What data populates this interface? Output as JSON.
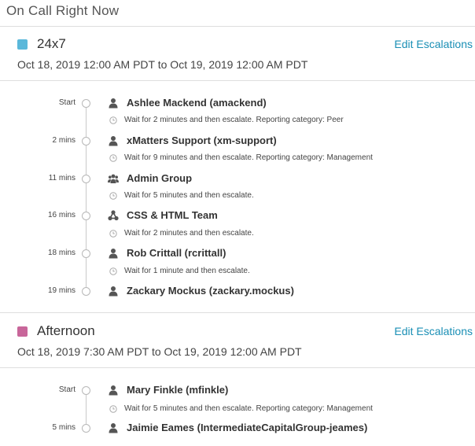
{
  "page": {
    "heading": "On Call Right Now"
  },
  "colors": {
    "accent_link": "#1a8fb5",
    "schedule_1": "#5ab8da",
    "schedule_2": "#c8669a"
  },
  "schedules": [
    {
      "name": "24x7",
      "edit_label": "Edit Escalations",
      "range": "Oct 18, 2019 12:00 AM PDT to Oct 19, 2019 12:00 AM PDT",
      "chip_color": "#5ab8da",
      "steps": [
        {
          "time": "Start",
          "icon": "user-icon",
          "name": "Ashlee Mackend (amackend)",
          "wait": "Wait for 2 minutes and then escalate. Reporting category: Peer"
        },
        {
          "time": "2 mins",
          "icon": "user-icon",
          "name": "xMatters Support (xm-support)",
          "wait": "Wait for 9 minutes and then escalate. Reporting category: Management"
        },
        {
          "time": "11 mins",
          "icon": "group-icon",
          "name": "Admin Group",
          "wait": "Wait for 5 minutes and then escalate."
        },
        {
          "time": "16 mins",
          "icon": "team-icon",
          "name": "CSS & HTML Team",
          "wait": "Wait for 2 minutes and then escalate."
        },
        {
          "time": "18 mins",
          "icon": "user-icon",
          "name": "Rob Crittall (rcrittall)",
          "wait": "Wait for 1 minute and then escalate."
        },
        {
          "time": "19 mins",
          "icon": "user-icon",
          "name": "Zackary Mockus (zackary.mockus)",
          "wait": ""
        }
      ]
    },
    {
      "name": "Afternoon",
      "edit_label": "Edit Escalations",
      "range": "Oct 18, 2019 7:30 AM PDT to Oct 19, 2019 12:00 AM PDT",
      "chip_color": "#c8669a",
      "steps": [
        {
          "time": "Start",
          "icon": "user-icon",
          "name": "Mary Finkle (mfinkle)",
          "wait": "Wait for 5 minutes and then escalate. Reporting category: Management"
        },
        {
          "time": "5 mins",
          "icon": "user-icon",
          "name": "Jaimie Eames (IntermediateCapitalGroup-jeames)",
          "wait": ""
        }
      ]
    }
  ]
}
